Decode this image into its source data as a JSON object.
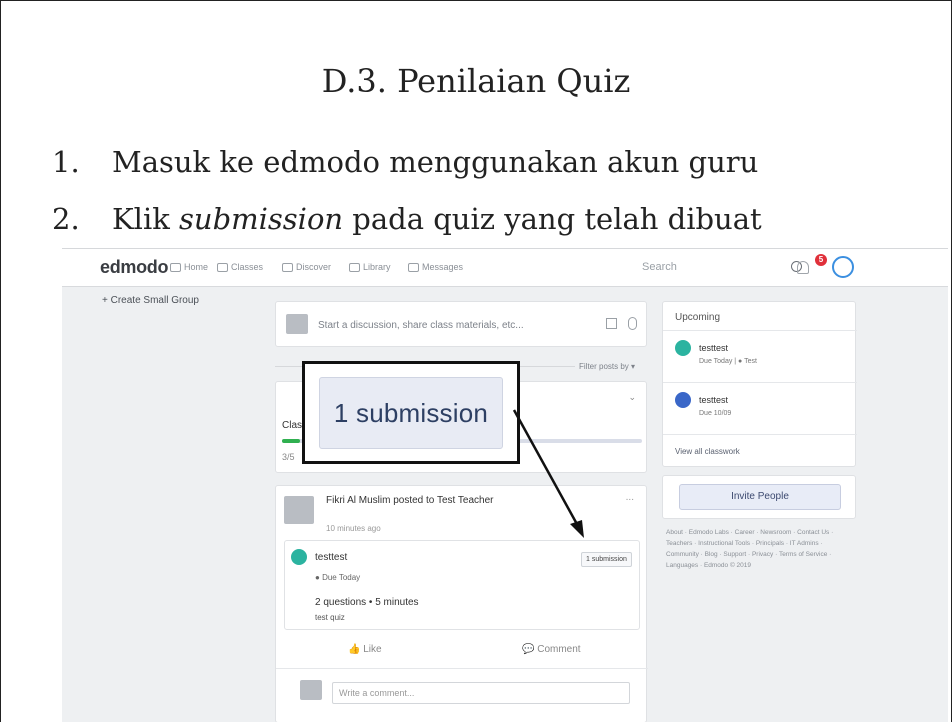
{
  "slide": {
    "title": "D.3. Penilaian Quiz",
    "steps": [
      {
        "num": "1.",
        "text": "Masuk ke edmodo menggunakan akun guru"
      },
      {
        "num": "2.",
        "pre": "Klik ",
        "em": "submission",
        "post": " pada quiz yang telah dibuat"
      }
    ]
  },
  "edmodo": {
    "logo": "edmodo",
    "nav": [
      "Home",
      "Classes",
      "Discover",
      "Library",
      "Messages"
    ],
    "search_placeholder": "Search",
    "notification_count": "5",
    "sidebar": {
      "create_group": "+ Create Small Group"
    },
    "composer": {
      "placeholder": "Start a discussion, share class materials, etc..."
    },
    "filter": "Filter posts by ▾",
    "class_card": {
      "label": "Clas",
      "count": "3/5"
    },
    "post": {
      "author": "Fikri Al Muslim posted to Test Teacher",
      "time": "10 minutes ago",
      "more": "...",
      "assignment": {
        "name": "testtest",
        "due": "Due Today",
        "meta": "2 questions • 5 minutes",
        "desc": "test quiz",
        "submission_button": "1 submission"
      },
      "like": "Like",
      "comment": "Comment",
      "comment_placeholder": "Write a comment..."
    },
    "upcoming": {
      "header": "Upcoming",
      "items": [
        {
          "name": "testtest",
          "due": "Due Today  |  ● Test",
          "color": "#2bb3a0"
        },
        {
          "name": "testtest",
          "due": "Due 10/09",
          "color": "#3a67c8"
        }
      ],
      "view_all": "View all classwork"
    },
    "invite": "Invite People",
    "footer": "About · Edmodo Labs · Career · Newsroom · Contact Us · Teachers · Instructional Tools · Principals · IT Admins · Community · Blog · Support · Privacy · Terms of Service · Languages · Edmodo © 2019"
  },
  "callout": {
    "label": "1 submission"
  }
}
